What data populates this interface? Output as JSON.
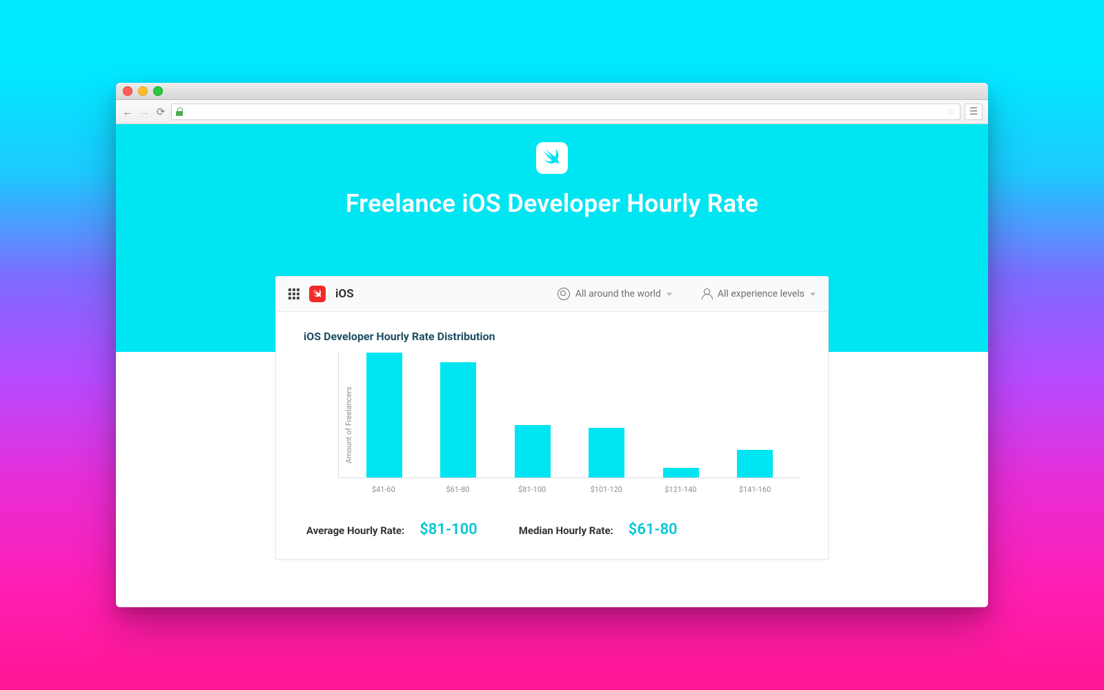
{
  "hero": {
    "title": "Freelance iOS Developer Hourly Rate"
  },
  "panel_bar": {
    "platform_label": "iOS",
    "location_filter": "All around the world",
    "experience_filter": "All experience levels"
  },
  "chart": {
    "title": "iOS Developer Hourly Rate Distribution",
    "ylabel": "Amount of Freelancers"
  },
  "stats": {
    "avg_label": "Average Hourly Rate:",
    "avg_value": "$81-100",
    "med_label": "Median Hourly Rate:",
    "med_value": "$61-80"
  },
  "chart_data": {
    "type": "bar",
    "title": "iOS Developer Hourly Rate Distribution",
    "xlabel": "",
    "ylabel": "Amount of Freelancers",
    "categories": [
      "$41-60",
      "$61-80",
      "$81-100",
      "$101-120",
      "$121-140",
      "$141-160"
    ],
    "values": [
      100,
      92,
      42,
      40,
      8,
      22
    ],
    "ylim": [
      0,
      100
    ],
    "note": "Y-axis has no numeric ticks; values are relative bar heights as percent of tallest bar."
  }
}
